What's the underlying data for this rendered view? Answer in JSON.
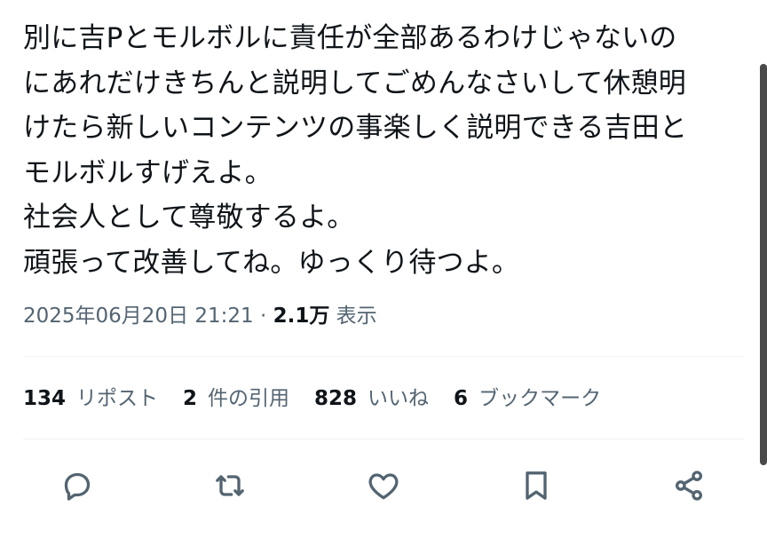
{
  "tweet": {
    "lines": [
      "別に吉Pとモルボルに責任が全部あるわけじゃないの",
      "にあれだけきちんと説明してごめんなさいして休憩明",
      "けたら新しいコンテンツの事楽しく説明できる吉田と",
      "モルボルすげえよ。",
      "社会人として尊敬するよ。",
      "頑張って改善してね。ゆっくり待つよ。"
    ]
  },
  "meta": {
    "timestamp": "2025年06月20日 21:21",
    "separator": "·",
    "views_count": "2.1万",
    "views_label": "表示"
  },
  "stats": {
    "reposts": {
      "count": "134",
      "label": "リポスト"
    },
    "quotes": {
      "count": "2",
      "label": "件の引用"
    },
    "likes": {
      "count": "828",
      "label": "いいね"
    },
    "bookmarks": {
      "count": "6",
      "label": "ブックマーク"
    }
  },
  "actions": {
    "icons": [
      "reply-icon",
      "repost-icon",
      "like-icon",
      "bookmark-icon",
      "share-icon"
    ],
    "icon_color": "#536471"
  },
  "colors": {
    "text": "#0f1419",
    "secondary": "#536471",
    "divider": "#eff3f4"
  }
}
